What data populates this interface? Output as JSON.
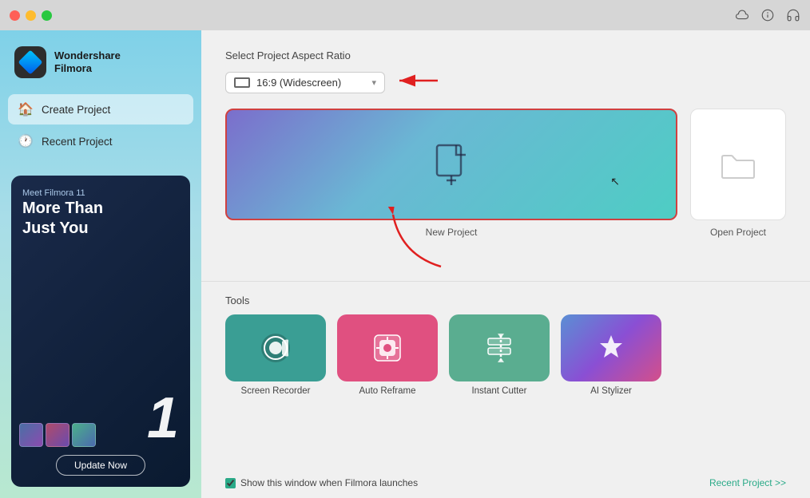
{
  "titlebar": {
    "buttons": [
      "close",
      "minimize",
      "maximize"
    ],
    "icons": [
      "cloud-icon",
      "info-icon",
      "headset-icon"
    ]
  },
  "sidebar": {
    "logo": {
      "brand_line1": "Wondershare",
      "brand_line2": "Filmora"
    },
    "nav_items": [
      {
        "id": "create-project",
        "label": "Create Project",
        "icon": "🏠",
        "active": true
      },
      {
        "id": "recent-project",
        "label": "Recent Project",
        "icon": "🕐",
        "active": false
      }
    ],
    "promo": {
      "meet": "Meet Filmora 11",
      "line1": "More Than",
      "line2": "Just You",
      "update_btn": "Update Now"
    }
  },
  "main": {
    "aspect_ratio": {
      "label": "Select Project Aspect Ratio",
      "value": "16:9 (Widescreen)"
    },
    "new_project": {
      "label": "New Project"
    },
    "open_project": {
      "label": "Open Project"
    },
    "tools": {
      "title": "Tools",
      "items": [
        {
          "id": "screen-recorder",
          "label": "Screen Recorder",
          "icon": "📹",
          "color": "teal"
        },
        {
          "id": "auto-reframe",
          "label": "Auto Reframe",
          "icon": "⬡",
          "color": "teal2"
        },
        {
          "id": "instant-cutter",
          "label": "Instant Cutter",
          "icon": "✂",
          "color": "teal3"
        },
        {
          "id": "ai-stylizer",
          "label": "AI Stylizer",
          "icon": "🎨",
          "color": "purple"
        }
      ]
    },
    "footer": {
      "checkbox_label": "Show this window when Filmora launches",
      "recent_link": "Recent Project >>"
    }
  }
}
